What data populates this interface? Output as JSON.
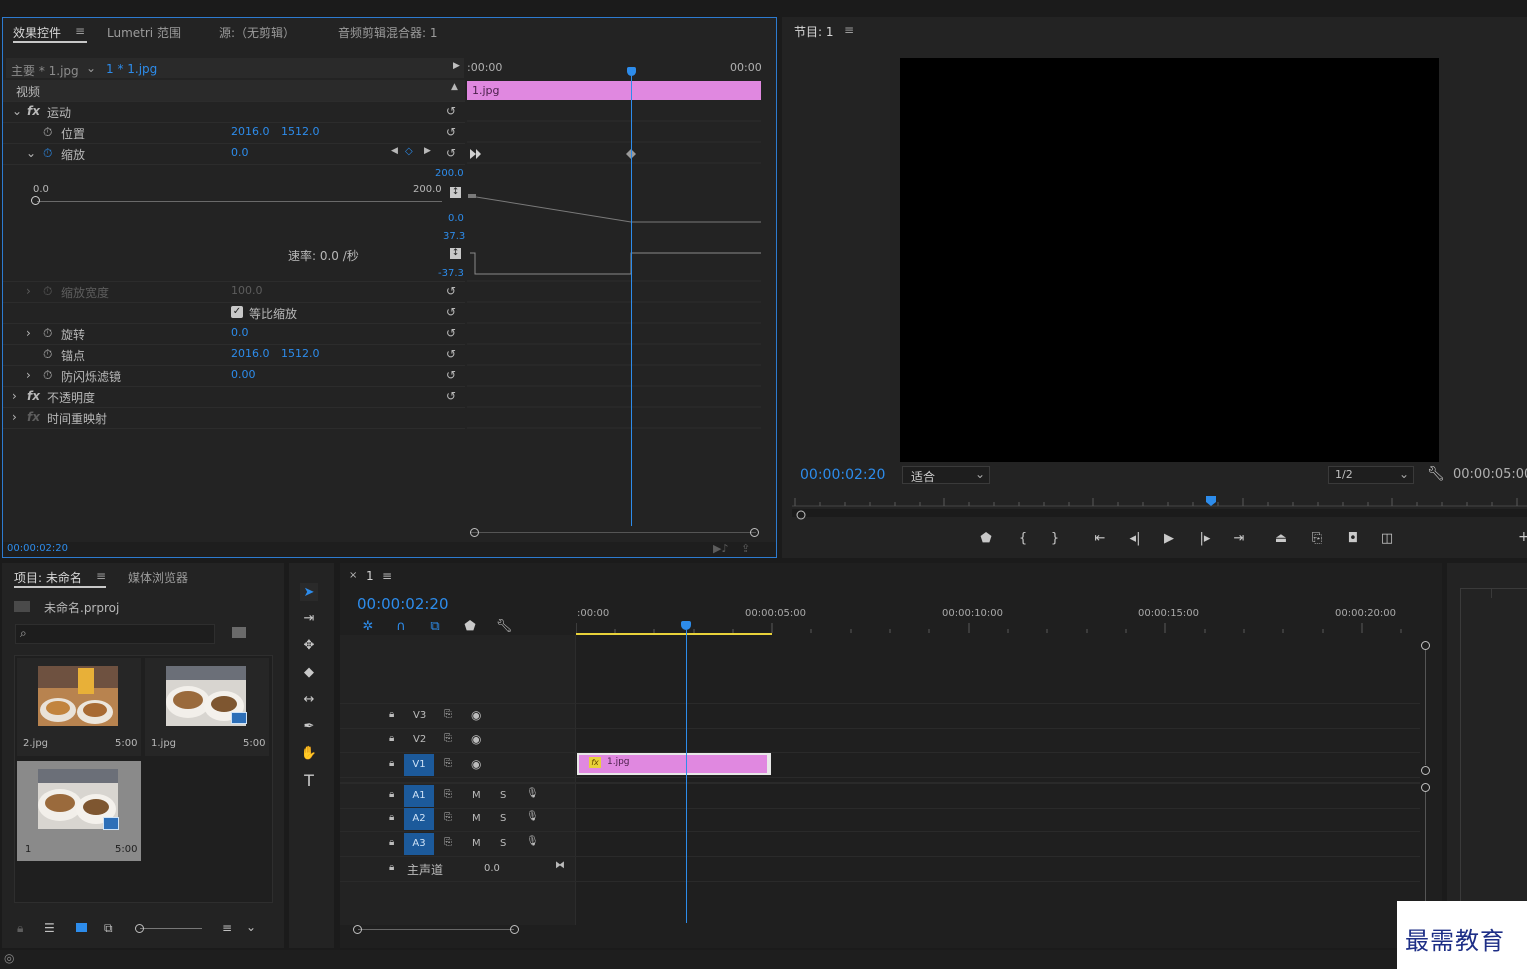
{
  "effects_panel": {
    "tabs": [
      "效果控件",
      "Lumetri 范围",
      "源:（无剪辑）",
      "音频剪辑混合器: 1"
    ],
    "menu_icon": "≡",
    "master_label": "主要 * 1.jpg",
    "clip_label": "1 * 1.jpg",
    "ruler_start": ":00:00",
    "ruler_end": "00:00",
    "clip_bar_label": "1.jpg",
    "section_video": "视频",
    "motion": "运动",
    "position_label": "位置",
    "position_x": "2016.0",
    "position_y": "1512.0",
    "scale_label": "缩放",
    "scale_value": "0.0",
    "slider_min": "0.0",
    "slider_max": "200.0",
    "graph_top": "200.0",
    "graph_bottom": "0.0",
    "velocity_top": "37.3",
    "velocity_bottom": "-37.3",
    "velocity_text": "速率: 0.0 /秒",
    "scale_width_label": "缩放宽度",
    "scale_width_value": "100.0",
    "uniform_scale_label": "等比缩放",
    "rotation_label": "旋转",
    "rotation_value": "0.0",
    "anchor_label": "锚点",
    "anchor_x": "2016.0",
    "anchor_y": "1512.0",
    "flicker_label": "防闪烁滤镜",
    "flicker_value": "0.00",
    "opacity": "不透明度",
    "time_remap": "时间重映射",
    "footer_timecode": "00:00:02:20",
    "fx": "fx"
  },
  "program_monitor": {
    "title": "节目: 1",
    "menu_icon": "≡",
    "timecode": "00:00:02:20",
    "fit_label": "适合",
    "resolution_label": "1/2",
    "duration": "00:00:05:00",
    "plus": "+"
  },
  "project_panel": {
    "tabs": [
      "项目: 未命名",
      "媒体浏览器"
    ],
    "menu_icon": "≡",
    "project_file": "未命名.prproj",
    "items": [
      {
        "name": "2.jpg",
        "duration": "5:00"
      },
      {
        "name": "1.jpg",
        "duration": "5:00"
      },
      {
        "name": "1",
        "duration": "5:00"
      }
    ]
  },
  "timeline": {
    "close": "×",
    "sequence_name": "1",
    "menu_icon": "≡",
    "timecode": "00:00:02:20",
    "ruler_labels": [
      ":00:00",
      "00:00:05:00",
      "00:00:10:00",
      "00:00:15:00",
      "00:00:20:00"
    ],
    "video_tracks": [
      "V3",
      "V2",
      "V1"
    ],
    "audio_tracks": [
      "A1",
      "A2",
      "A3"
    ],
    "mute": "M",
    "solo": "S",
    "master_label": "主声道",
    "master_value": "0.0",
    "clip_label": "1.jpg",
    "clip_fx": "fx"
  },
  "watermark": "最需教育",
  "colors": {
    "accent": "#2d8ceb",
    "clip": "#e088e0",
    "track_blue": "#1c5a9b",
    "work_area": "#e8d23a"
  }
}
